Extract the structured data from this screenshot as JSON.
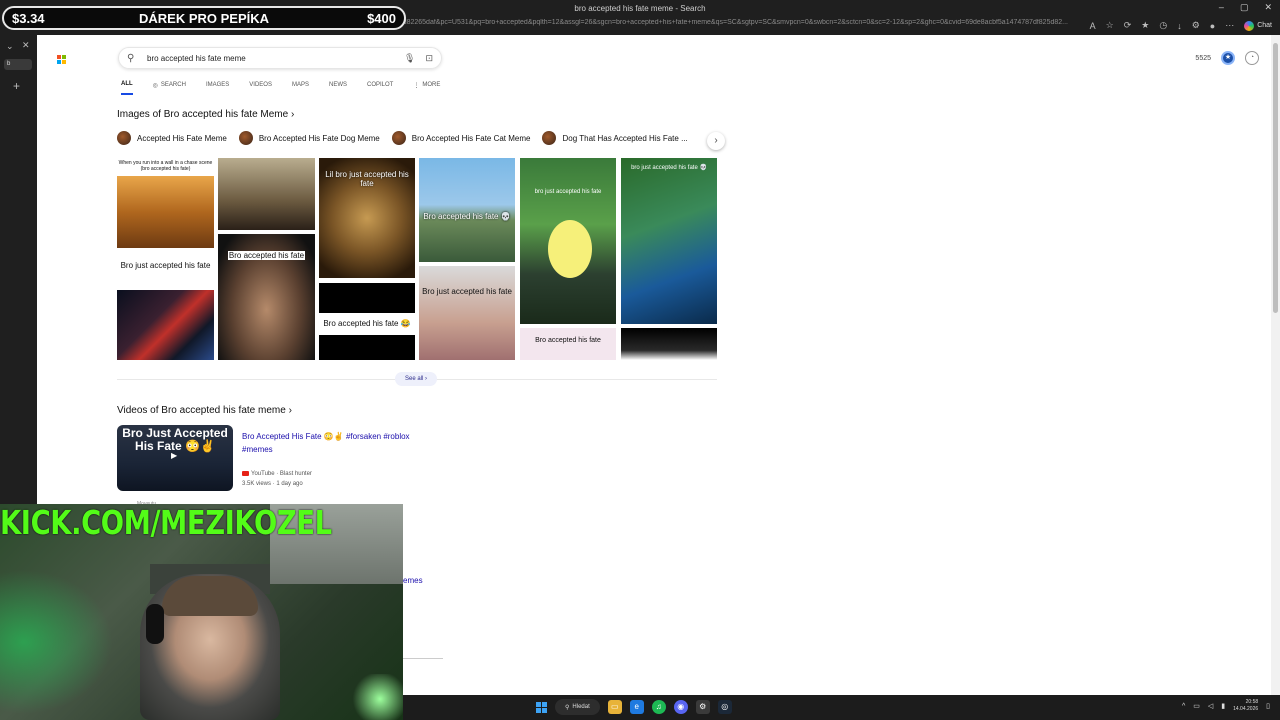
{
  "window": {
    "title": "bro accepted his fate meme - Search",
    "url": "https://www.bing.com/search?q=bro+accepted+his+fate+meme&form=ANNNB1&refig=69de8acbf5a1474787df825d82265daf&pc=U531&pq=bro+accepted&pqlth=12&assgl=26&sgcn=bro+accepted+his+fate+meme&qs=SC&sgtpv=SC&smvpcn=0&swbcn=2&sctcn=0&sc=2-12&sp=2&ghc=0&cvid=69de8acbf5a1474787df825d82...",
    "controls": {
      "minimize": "–",
      "maximize": "▢",
      "close": "✕"
    },
    "copilot_label": "Chat",
    "sidebar_tab_label": "b"
  },
  "donation": {
    "left": "$3.34",
    "message": "DÁREK PRO PEPÍKA",
    "right": "$400"
  },
  "search": {
    "query": "bro accepted his fate meme",
    "points": "5525"
  },
  "tabs": [
    {
      "label": "ALL",
      "active": true
    },
    {
      "label": "SEARCH"
    },
    {
      "label": "IMAGES"
    },
    {
      "label": "VIDEOS"
    },
    {
      "label": "MAPS"
    },
    {
      "label": "NEWS"
    },
    {
      "label": "COPILOT"
    },
    {
      "label": "MORE"
    }
  ],
  "images_section": {
    "title": "Images of Bro accepted his fate Meme",
    "chips": [
      "Accepted His Fate Meme",
      "Bro Accepted His Fate Dog Meme",
      "Bro Accepted His Fate Cat Meme",
      "Dog That Has Accepted His Fate ..."
    ],
    "captions": {
      "dog": "When you run into a wall in a chase scene (bro accepted his fate)",
      "text_card": "Bro just accepted his fate",
      "man": "Bro accepted his fate",
      "leopard": "Lil bro just accepted his fate",
      "plane": "Bro accepted his fate 💀",
      "black": "Bro accepted his fate 😂",
      "grey_card": "Bro just accepted his fate",
      "game": "bro just accepted his fate",
      "goku": "bro just accepted his fate 💀",
      "pink_card": "Bro accepted his fate"
    },
    "see_all": "See all"
  },
  "videos_section": {
    "title": "Videos of Bro accepted his fate meme",
    "thumb_title": "Bro Just Accepted His Fate 😳✌️",
    "video_title": "Bro Accepted His Fate 😳✌️ #forsaken #roblox #memes",
    "source": "YouTube · Blast hunter",
    "stats": "3.5K views · 1 day ago",
    "stray_text": "emes",
    "stray_source": "Moveutu"
  },
  "stream": {
    "channel": "KICK.COM/MEZIKOZEL"
  },
  "taskbar": {
    "search_label": "Hledat",
    "time": "20:58",
    "date": "14.04.2026"
  }
}
